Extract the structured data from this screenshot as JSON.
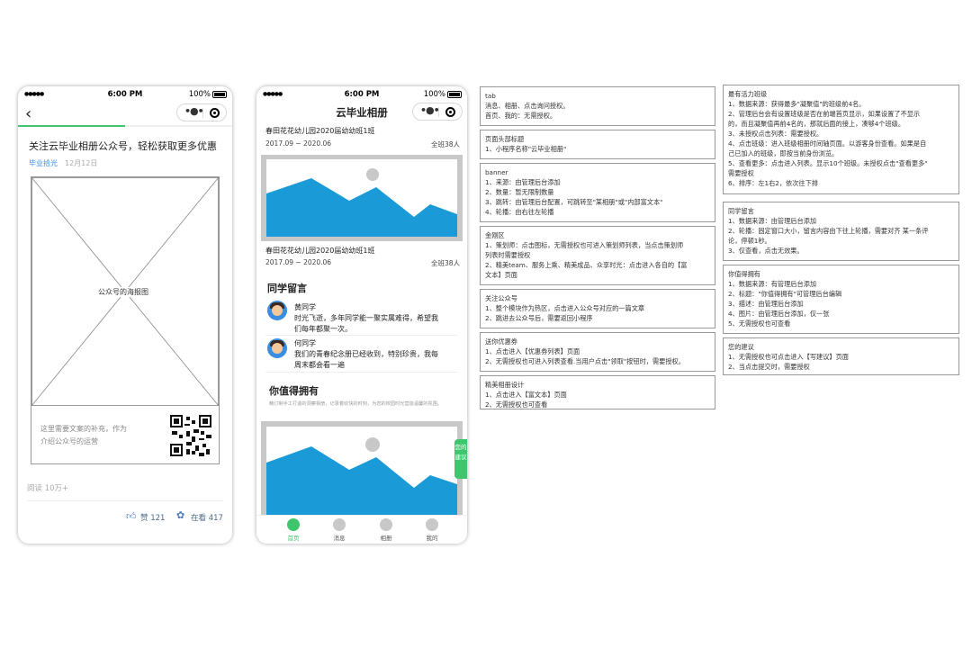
{
  "phone1": {
    "status": {
      "signal": "●●●●● ",
      "time": "6:00 PM",
      "battery": "100%"
    },
    "back_icon": "back-arrow-icon",
    "progress": 0.5,
    "article_title": "关注云毕业相册公众号，轻松获取更多优惠",
    "author": "毕业拾光",
    "date": "12月12日",
    "poster_label": "公众号的海报图",
    "intro_text_line1": "这里需要文案的补充，作为",
    "intro_text_line2": "介绍公众号的运营",
    "read_count": "阅读 10万+",
    "like_label": "赞 121",
    "watching_label": "在看 417"
  },
  "phone2": {
    "status": {
      "signal": "●●●●● ",
      "time": "6:00 PM",
      "battery": "100%"
    },
    "app_title": "云毕业相册",
    "class1": {
      "name": "春田花花幼儿园2020届幼幼班1班",
      "period": "2017.09 ~ 2020.06",
      "count": "全班38人"
    },
    "class2": {
      "name": "春田花花幼儿园2020届幼幼班1班",
      "period": "2017.09 ~ 2020.06",
      "count": "全班38人"
    },
    "messages_title": "同学留言",
    "messages": [
      {
        "name": "黄同学",
        "line1": "时光飞逝，多年同学能一聚实属难得，希望我",
        "line2": "们每年都聚一次。"
      },
      {
        "name": "何同学",
        "line1": "我们的青春纪念册已经收到，特别珍贵，我每",
        "line2": "周末都会看一遍"
      }
    ],
    "worth_title": "你值得拥有",
    "worth_desc": "精订制手工打造的洞察相册，记录着欢快的时刻，为您的校园时光营造温馨的氛围。",
    "suggest_tab": "您的建议",
    "nav": [
      "首页",
      "消息",
      "相册",
      "我的"
    ]
  },
  "notes_col1": [
    {
      "title": "tab",
      "lines": [
        "消息、相册、点击询问授权。",
        "首页、我的：无需授权。"
      ]
    },
    {
      "title": "页面头部标题",
      "lines": [
        "1、小程序名称\"云毕业相册\""
      ]
    },
    {
      "title": "banner",
      "lines": [
        "1、来源：由管理后台添加",
        "2、数量：暂无限制数量",
        "3、跳转：由管理后台配置，可跳转至\"某相册\"或\"内部富文本\"",
        "4、轮播：由右往左轮播"
      ]
    },
    {
      "title": "金刚区",
      "lines": [
        "1、策划师：点击图标，无需授权也可进入策划师列表，当点击策划师",
        "列表时需要授权",
        "2、精美team、服务上乘、精美成品、众享时光：点击进入各自的【富",
        "文本】页面"
      ]
    },
    {
      "title": "关注公众号",
      "lines": [
        "1、整个模块作为热区，点击进入公众号对应的一篇文章",
        "2、跳进去公众号后，需要返回小程序"
      ]
    },
    {
      "title": "送你优惠券",
      "lines": [
        "1、点击进入【优惠券列表】页面",
        "2、无需授权也可进入列表查看.当用户点击\"领取\"按钮时，需要授权。"
      ]
    },
    {
      "title": "精美相册设计",
      "lines": [
        "1、点击进入【富文本】页面",
        "2、无需授权也可查看"
      ]
    }
  ],
  "notes_col2": [
    {
      "title": "最有活力班级",
      "lines": [
        "1、数据来源：获得最多\"凝聚值\"的班级前4名。",
        "2、管理后台会有设置班级是否在前端首页显示，如果设置了不显示",
        "的，而且凝聚值再前4名的，那就后面的接上，凑够4个班级。",
        "3、未授权点击列表：需要授权。",
        "4、点击班级：进入班级相册时间轴页面。以游客身份查看。如果是自",
        "己已加入的班级，即按当前身份浏览。",
        "5、查看更多：点击进入列表。显示10个班级。未授权点击\"查看更多\"",
        "需要授权",
        "6、排序：左1右2，依次往下排"
      ]
    },
    {
      "title": "同学留言",
      "lines": [
        "1、数据来源：由管理后台添加",
        "2、轮播：固定窗口大小，留言内容由下往上轮播，需要对齐 某一条评",
        "论，停顿1秒。",
        "3、仅查看，点击无效果。"
      ]
    },
    {
      "title": "你值得拥有",
      "lines": [
        "1、数据来源：有管理后台添加",
        "2、标题：\"你值得拥有\"可管理后台编辑",
        "3、描述：由管理后台添加",
        "4、图片：由管理后台添加，仅一张",
        "5、无需授权也可查看"
      ]
    },
    {
      "title": "您的建议",
      "lines": [
        "1、无需授权也可点击进入【写建议】页面",
        "2、当点击提交时，需要授权"
      ]
    }
  ],
  "colors": {
    "accent_green": "#3fc66d",
    "link_blue": "#3a8de0",
    "chart_blue": "#1a9bd7",
    "placeholder_gray": "#c8c8c8"
  }
}
